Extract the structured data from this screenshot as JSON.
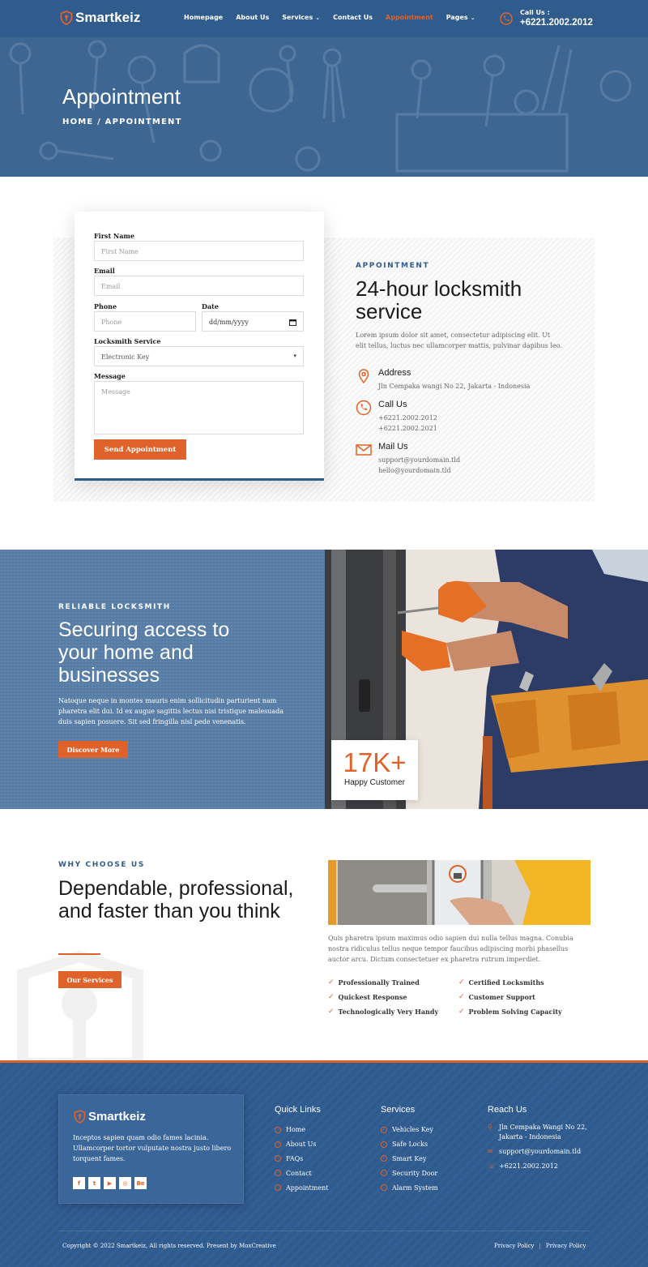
{
  "brand": {
    "name": "Smartkeiz"
  },
  "nav": {
    "items": [
      "Homepage",
      "About Us",
      "Services",
      "Contact Us",
      "Appointment",
      "Pages"
    ],
    "active_index": 4
  },
  "header_call": {
    "label": "Call Us :",
    "number": "+6221.2002.2012"
  },
  "hero": {
    "title": "Appointment",
    "breadcrumb": "HOME  /  APPOINTMENT"
  },
  "form": {
    "first_name": {
      "label": "First Name",
      "placeholder": "First Name"
    },
    "email": {
      "label": "Email",
      "placeholder": "Email"
    },
    "phone": {
      "label": "Phone",
      "placeholder": "Phone"
    },
    "date": {
      "label": "Date",
      "value": "dd/mm/yyyy"
    },
    "service": {
      "label": "Locksmith Service",
      "value": "Electronic Key"
    },
    "message": {
      "label": "Message",
      "placeholder": "Message"
    },
    "submit_label": "Send Appointment"
  },
  "appointment_info": {
    "eyebrow": "APPOINTMENT",
    "title": "24-hour locksmith service",
    "text": "Lorem ipsum dolor sit amet, consectetur adipiscing elit. Ut elit tellus, luctus nec ullamcorper mattis, pulvinar dapibus leo.",
    "address": {
      "title": "Address",
      "value": "Jln Cempaka wangi No 22, Jakarta - Indonesia"
    },
    "call": {
      "title": "Call Us",
      "line1": "+6221.2002.2012",
      "line2": "+6221.2002.2021"
    },
    "mail": {
      "title": "Mail Us",
      "line1": "support@yourdomain.tld",
      "line2": "hello@yourdomain.tld"
    }
  },
  "reliable": {
    "eyebrow": "RELIABLE LOCKSMITH",
    "title": "Securing access to your home and businesses",
    "text": "Natoque neque in montes mauris enim sollicitudin parturient nam pharetra elit dui. Id ex augue sagittis lectus nisi tristique malesuada duis sapien posuere. Sit sed fringilla nisl pede venenatis.",
    "button": "Discover More",
    "stat_value": "17K+",
    "stat_label": "Happy Customer"
  },
  "why": {
    "eyebrow": "WHY CHOOSE US",
    "title": "Dependable, professional, and faster than you think",
    "button": "Our Services",
    "text": "Quis pharetra ipsum maximus odio sapien dui nulla tellus magna. Conubia nostra ridiculus tellus neque tempor faucibus adipiscing morbi phasellus auctor arcu. Dictum consectetuer ex pharetra rutrum imperdiet.",
    "features_left": [
      "Professionally Trained",
      "Quickest Response",
      "Technologically Very Handy"
    ],
    "features_right": [
      "Certified Locksmiths",
      "Customer Support",
      "Problem Solving Capacity"
    ]
  },
  "footer": {
    "about": "Inceptos sapien quam odio fames lacinia. Ullamcorper tortor vulputate nostra justo libero torquent fames.",
    "socials": [
      "f",
      "t",
      "yt",
      "ig",
      "Be"
    ],
    "quick_links": {
      "title": "Quick Links",
      "items": [
        "Home",
        "About Us",
        "FAQs",
        "Contact",
        "Appointment"
      ]
    },
    "services": {
      "title": "Services",
      "items": [
        "Vehicles Key",
        "Safe Locks",
        "Smart Key",
        "Security Door",
        "Alarm System"
      ]
    },
    "reach": {
      "title": "Reach Us",
      "address": "Jln Cempaka Wangi No 22, Jakarta - Indonesia",
      "email": "support@yourdomain.tld",
      "phone": "+6221.2002.2012"
    },
    "copyright": "Copyright © 2022 Smartkeiz, All rights reserved. Present by MoxCreative",
    "legal_links": [
      "Privacy Policy",
      "Privacy Policy"
    ]
  },
  "colors": {
    "primary": "#2f5b8d",
    "accent": "#e0622b"
  }
}
